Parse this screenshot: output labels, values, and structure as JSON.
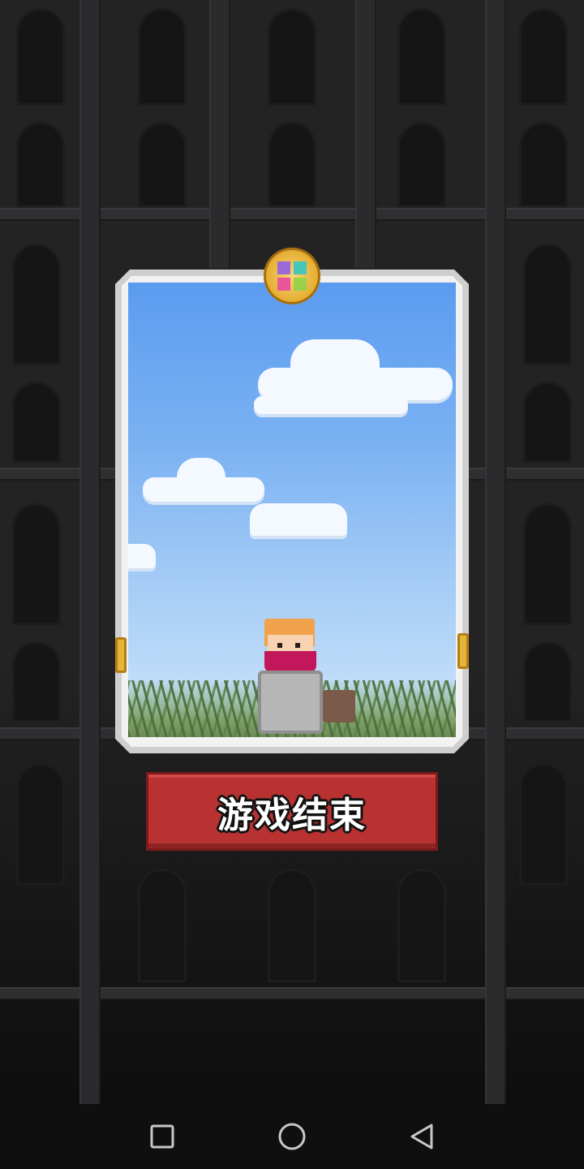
{
  "game_over_button": {
    "label": "游戏结束"
  },
  "navigation_bar": {
    "recent_apps_icon": "square-icon",
    "home_icon": "circle-icon",
    "back_icon": "triangle-back-icon"
  },
  "colors": {
    "button_red": "#b83232",
    "card_frame": "#cfcfcf",
    "sky_top": "#5b9cf0",
    "sky_bottom": "#cfe5fa",
    "emblem_gold": "#e4ad2f",
    "background": "#232324"
  }
}
